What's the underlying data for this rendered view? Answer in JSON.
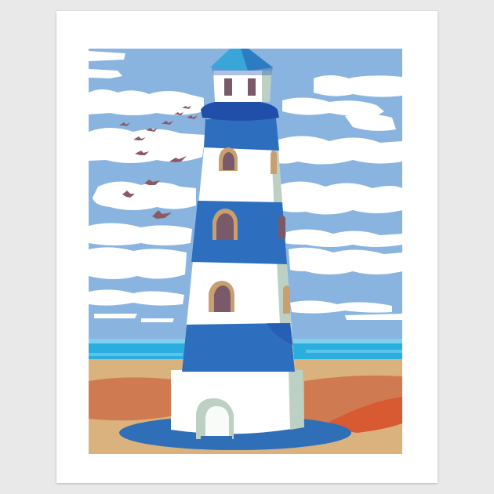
{
  "artwork": {
    "subject": "lighthouse",
    "birds_count": 12,
    "colors": {
      "sky": "#8ab4e0",
      "cloud": "#ffffff",
      "sea": "#2aaee0",
      "sea_light": "#7fd0ee",
      "sand": "#d9b27e",
      "sand_dark": "#cf7a50",
      "sand_red": "#d85a32",
      "stripe_blue": "#2d6fbe",
      "tower_white": "#ffffff",
      "tower_shade": "#bcd0c4",
      "window": "#7a5a6a",
      "window_frame": "#c8a070",
      "roof": "#3aa6d8",
      "gallery": "#1f4fa8",
      "shadow_pool": "#2f6fb8",
      "bird": "#8a5a62"
    },
    "icons": [
      "lighthouse-icon",
      "bird-icon",
      "cloud-icon"
    ]
  }
}
